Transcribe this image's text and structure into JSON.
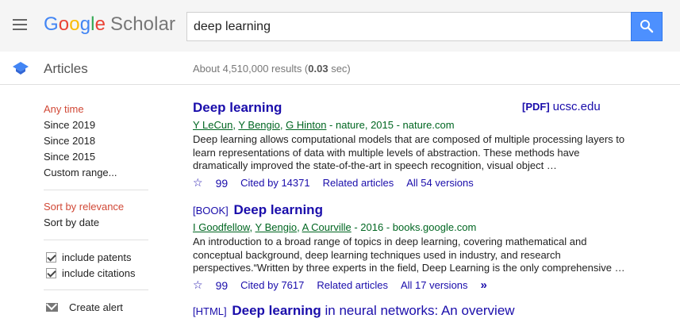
{
  "header": {
    "logo": {
      "g1": "G",
      "g2": "o",
      "g3": "o",
      "g4": "g",
      "g5": "l",
      "g6": "e",
      "scholar": "Scholar"
    },
    "search_value": "deep learning"
  },
  "subbar": {
    "section_label": "Articles",
    "count_prefix": "About 4,510,000 results (",
    "count_time": "0.03",
    "count_suffix": " sec)"
  },
  "sidebar": {
    "time_filters": [
      "Any time",
      "Since 2019",
      "Since 2018",
      "Since 2015",
      "Custom range..."
    ],
    "sort_options": [
      "Sort by relevance",
      "Sort by date"
    ],
    "checkboxes": [
      "include patents",
      "include citations"
    ],
    "create_alert": "Create alert"
  },
  "results": [
    {
      "tag": "",
      "title_bold": "Deep learning",
      "title_rest": "",
      "side_tag": "[PDF]",
      "side_domain": "ucsc.edu",
      "authors": [
        "Y LeCun",
        "Y Bengio",
        "G Hinton"
      ],
      "source": " - nature, 2015 - nature.com",
      "snippet": "Deep learning allows computational models that are composed of multiple processing layers to learn representations of data with multiple levels of abstraction. These methods have dramatically improved the state-of-the-art in speech recognition, visual object …",
      "cited_by": "Cited by 14371",
      "related": "Related articles",
      "versions": "All 54 versions",
      "more": ""
    },
    {
      "tag": "[BOOK]",
      "title_bold": "Deep learning",
      "title_rest": "",
      "side_tag": "",
      "side_domain": "",
      "authors": [
        "I Goodfellow",
        "Y Bengio",
        "A Courville"
      ],
      "source": " - 2016 - books.google.com",
      "snippet": "An introduction to a broad range of topics in deep learning, covering mathematical and conceptual background, deep learning techniques used in industry, and research perspectives.“Written by three experts in the field, Deep Learning is the only comprehensive …",
      "cited_by": "Cited by 7617",
      "related": "Related articles",
      "versions": "All 17 versions",
      "more": "»"
    },
    {
      "tag": "[HTML]",
      "title_bold": "Deep learning",
      "title_rest": " in neural networks: An overview"
    }
  ],
  "icons": {
    "star": "☆",
    "quote": "99"
  },
  "colors": {
    "link": "#1a0dab",
    "author": "#006621",
    "active": "#d14836",
    "search_btn": "#4d90fe"
  }
}
